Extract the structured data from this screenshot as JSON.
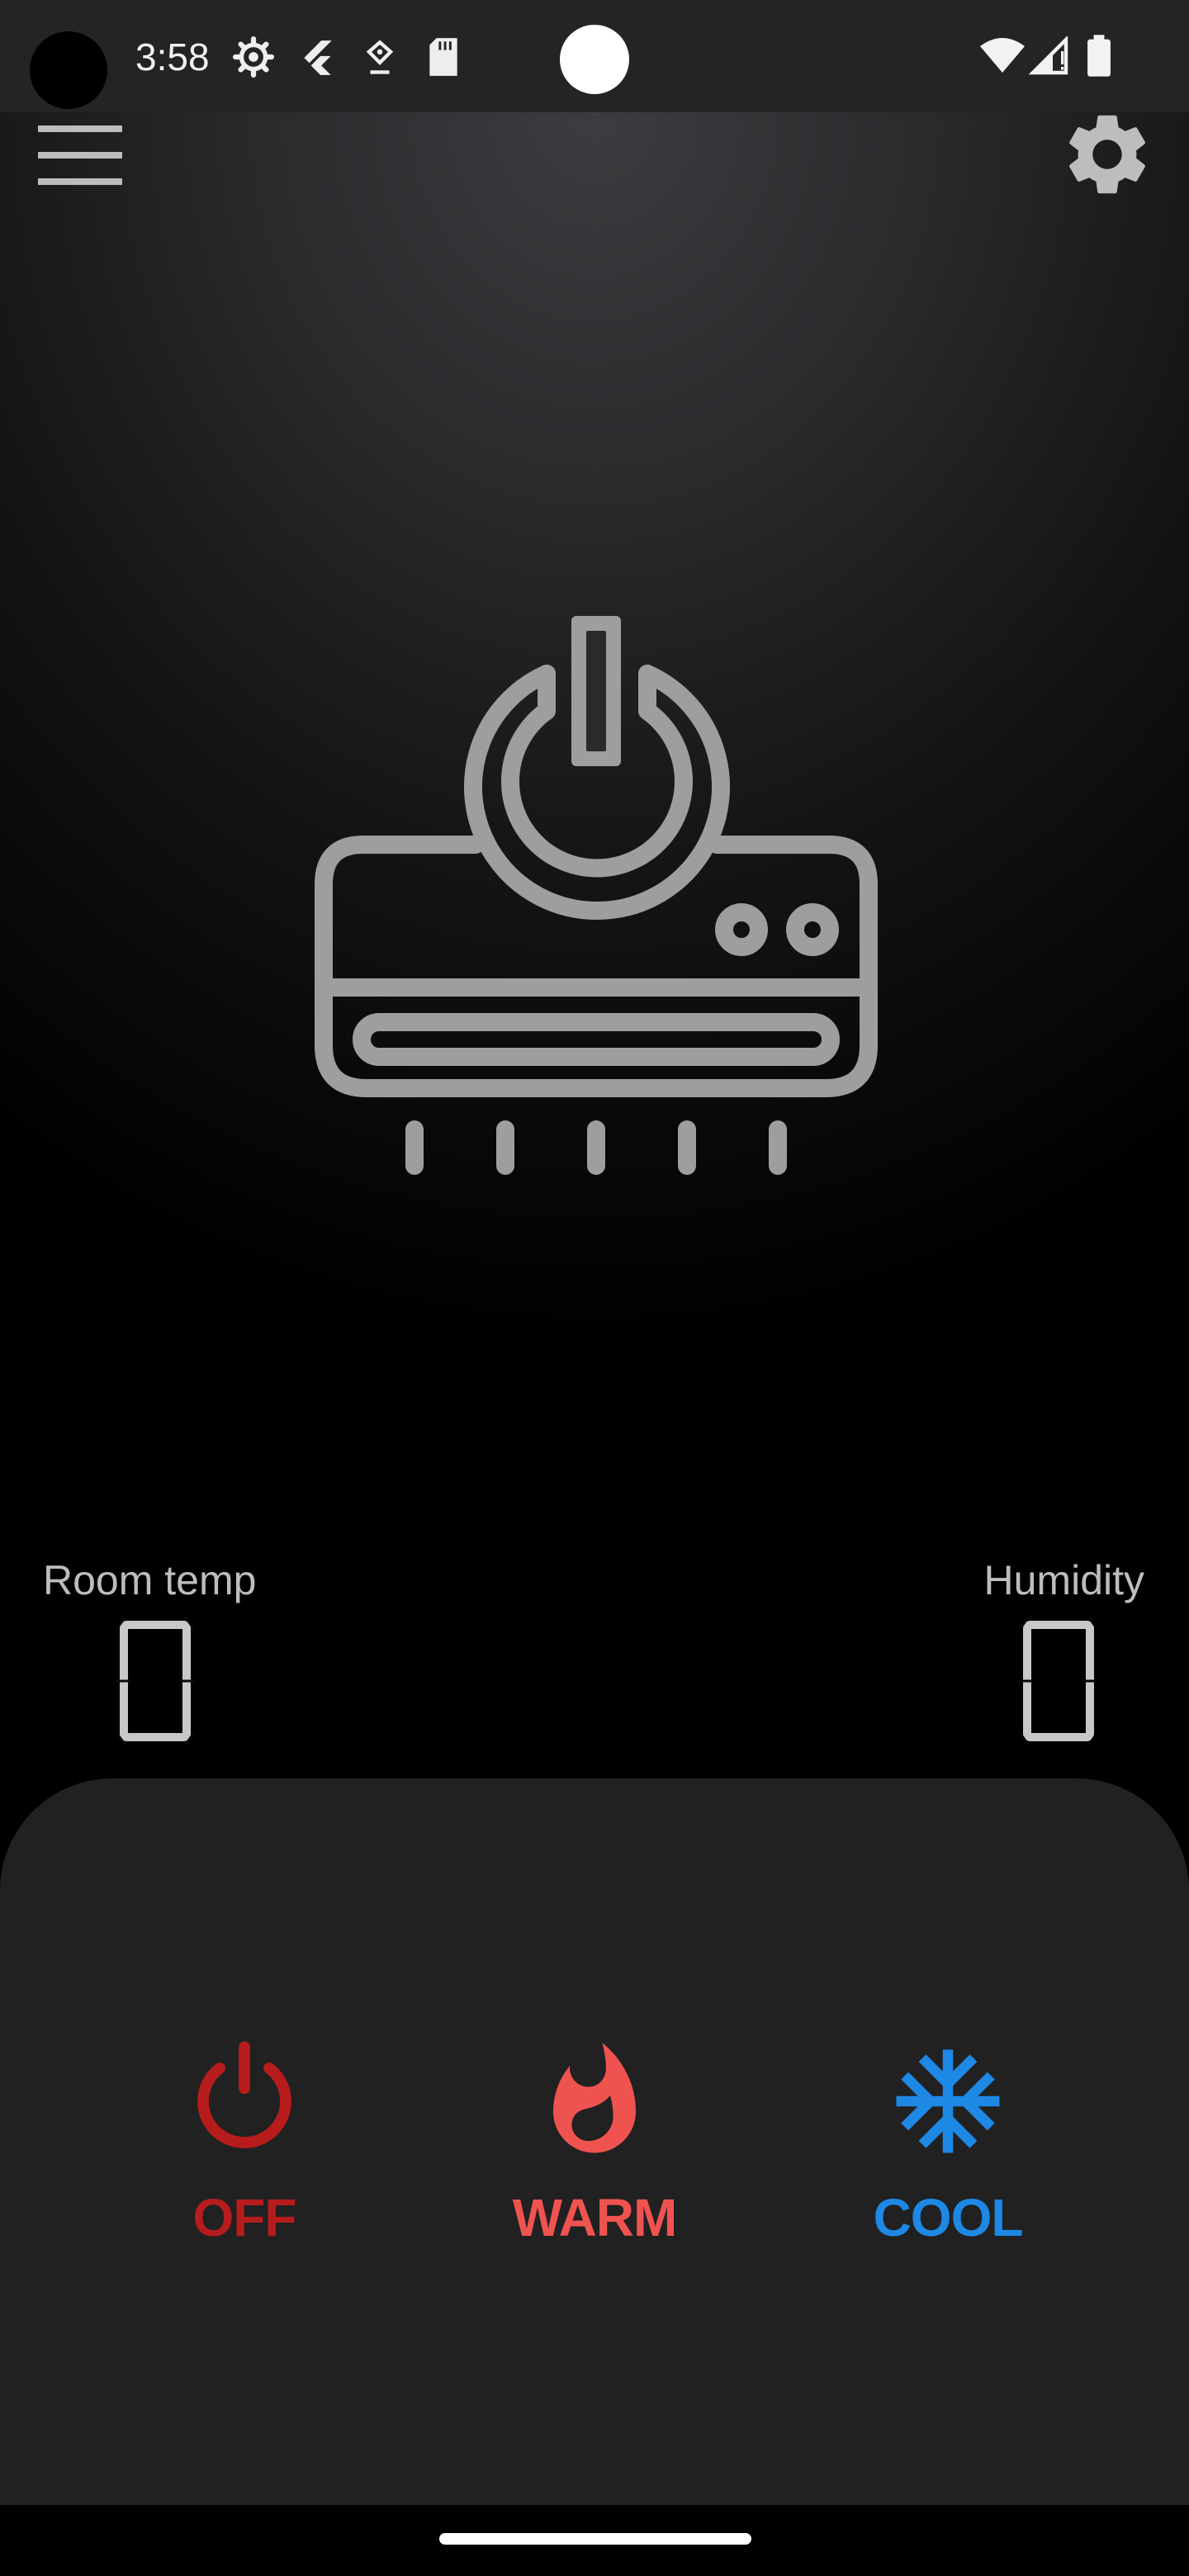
{
  "status_bar": {
    "time": "3:58",
    "icons": [
      "settings-gear-icon",
      "flutter-icon",
      "location-pin-icon",
      "sd-card-icon",
      "wifi-icon",
      "cell-signal-icon",
      "battery-icon"
    ]
  },
  "app_bar": {
    "menu_icon": "hamburger-menu-icon",
    "settings_icon": "gear-icon"
  },
  "hero": {
    "icon": "air-conditioner-power-icon"
  },
  "readings": {
    "room_temp": {
      "label": "Room temp",
      "value": "0"
    },
    "humidity": {
      "label": "Humidity",
      "value": "0"
    }
  },
  "modes": [
    {
      "id": "off",
      "label": "OFF",
      "icon": "power-icon",
      "color": "#b71c1c"
    },
    {
      "id": "warm",
      "label": "WARM",
      "icon": "flame-icon",
      "color": "#ef5350"
    },
    {
      "id": "cool",
      "label": "COOL",
      "icon": "snowflake-icon",
      "color": "#1e88e5"
    }
  ],
  "colors": {
    "background_top": "#3c3d40",
    "background_bottom": "#000000",
    "sheet": "#212121",
    "icon_gray": "#9e9e9e"
  }
}
